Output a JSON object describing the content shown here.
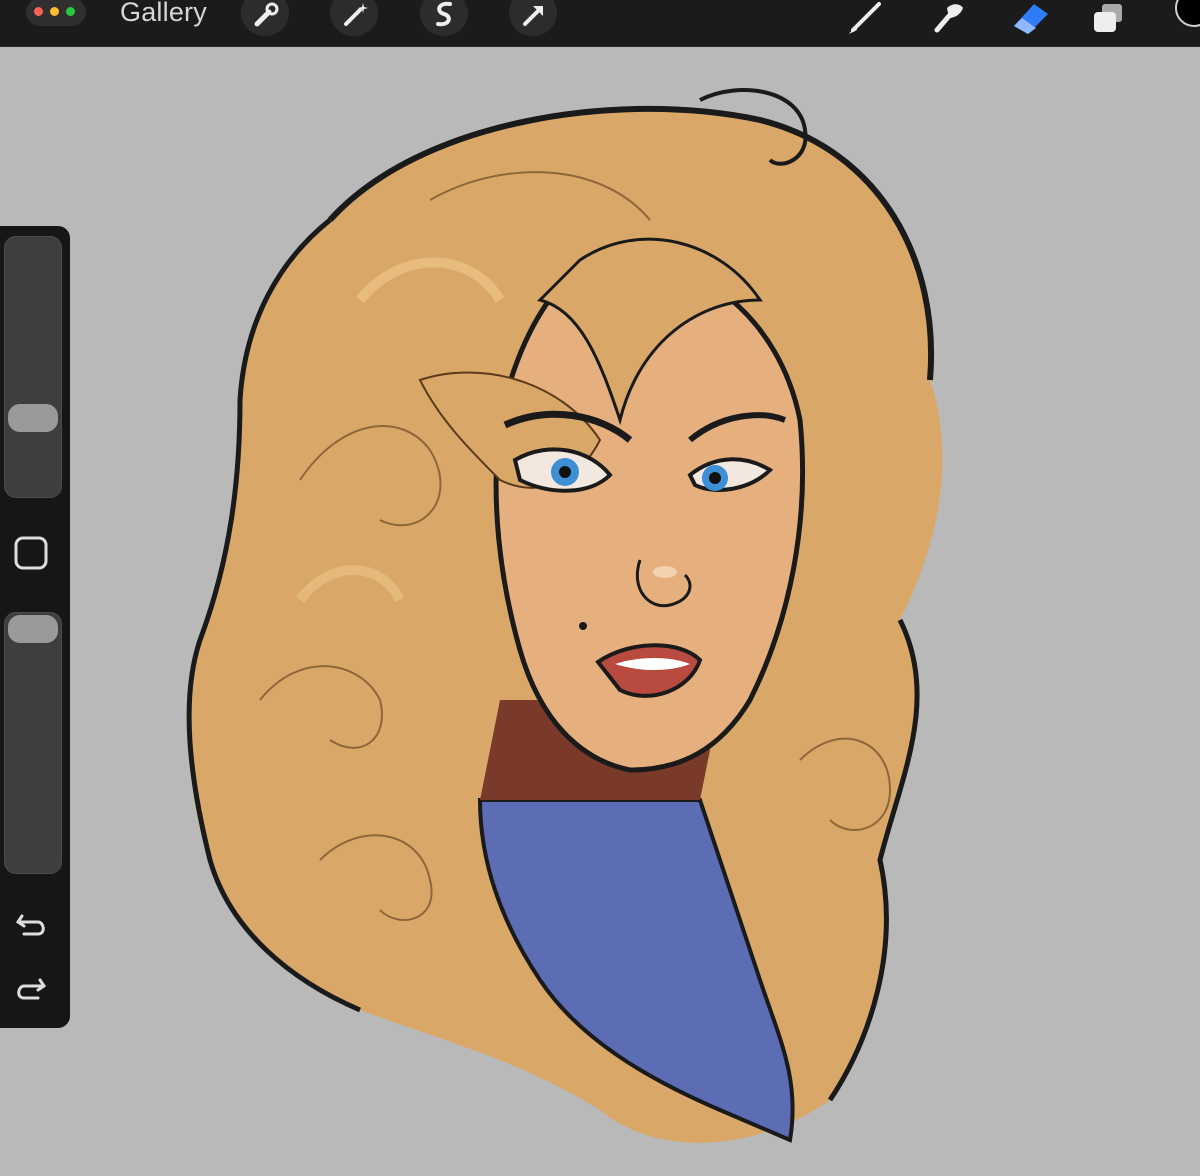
{
  "toolbar": {
    "gallery_label": "Gallery",
    "left_tools": [
      "wrench-icon",
      "magic-wand-icon",
      "selection-s-icon",
      "transform-arrow-icon"
    ],
    "right_tools": [
      "brush-icon",
      "smudge-icon",
      "eraser-icon",
      "layers-icon",
      "color-icon"
    ],
    "active_tool": "eraser",
    "accent_color": "#2f7cf6",
    "current_color": "#000000"
  },
  "sidebar": {
    "brush_size_level": 0.29,
    "opacity_level": 1.0,
    "modify_button": "square-modify-icon",
    "undo": "undo-icon",
    "redo": "redo-icon"
  },
  "canvas": {
    "background_color": "#b9b9b9",
    "artwork": "portrait-sketch"
  },
  "window_dots": [
    "#ff5f57",
    "#febc2e",
    "#28c840"
  ]
}
